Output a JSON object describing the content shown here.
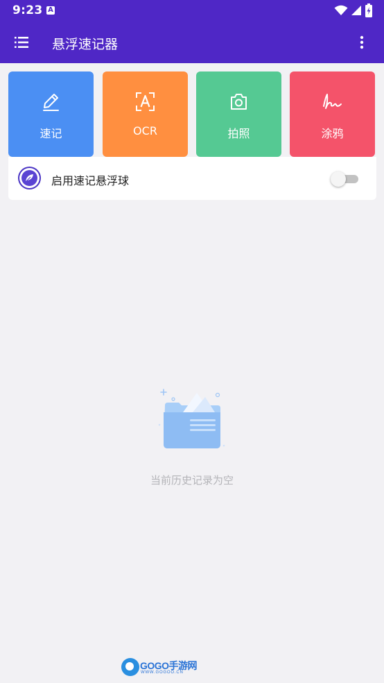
{
  "status_bar": {
    "time": "9:23",
    "notification_icon": "a-icon",
    "icons": [
      "wifi-icon",
      "signal-icon",
      "battery-icon"
    ]
  },
  "app_bar": {
    "title": "悬浮速记器",
    "menu_icon": "menu-icon",
    "more_icon": "more-vert-icon",
    "color": "#4f27c6"
  },
  "tiles": [
    {
      "label": "速记",
      "icon": "pencil-icon",
      "color": "#4b8ff3"
    },
    {
      "label": "OCR",
      "icon": "ocr-scan-icon",
      "color": "#ff8f40"
    },
    {
      "label": "拍照",
      "icon": "camera-icon",
      "color": "#55c993"
    },
    {
      "label": "涂鸦",
      "icon": "scribble-icon",
      "color": "#f4536a"
    }
  ],
  "floating_ball": {
    "label": "启用速记悬浮球",
    "icon": "feather-icon",
    "enabled": false
  },
  "empty_state": {
    "illustration": "empty-folder-icon",
    "text": "当前历史记录为空"
  },
  "watermark": {
    "text": "GOGO手游网",
    "sub": "WWW.GOGOO.CN"
  }
}
